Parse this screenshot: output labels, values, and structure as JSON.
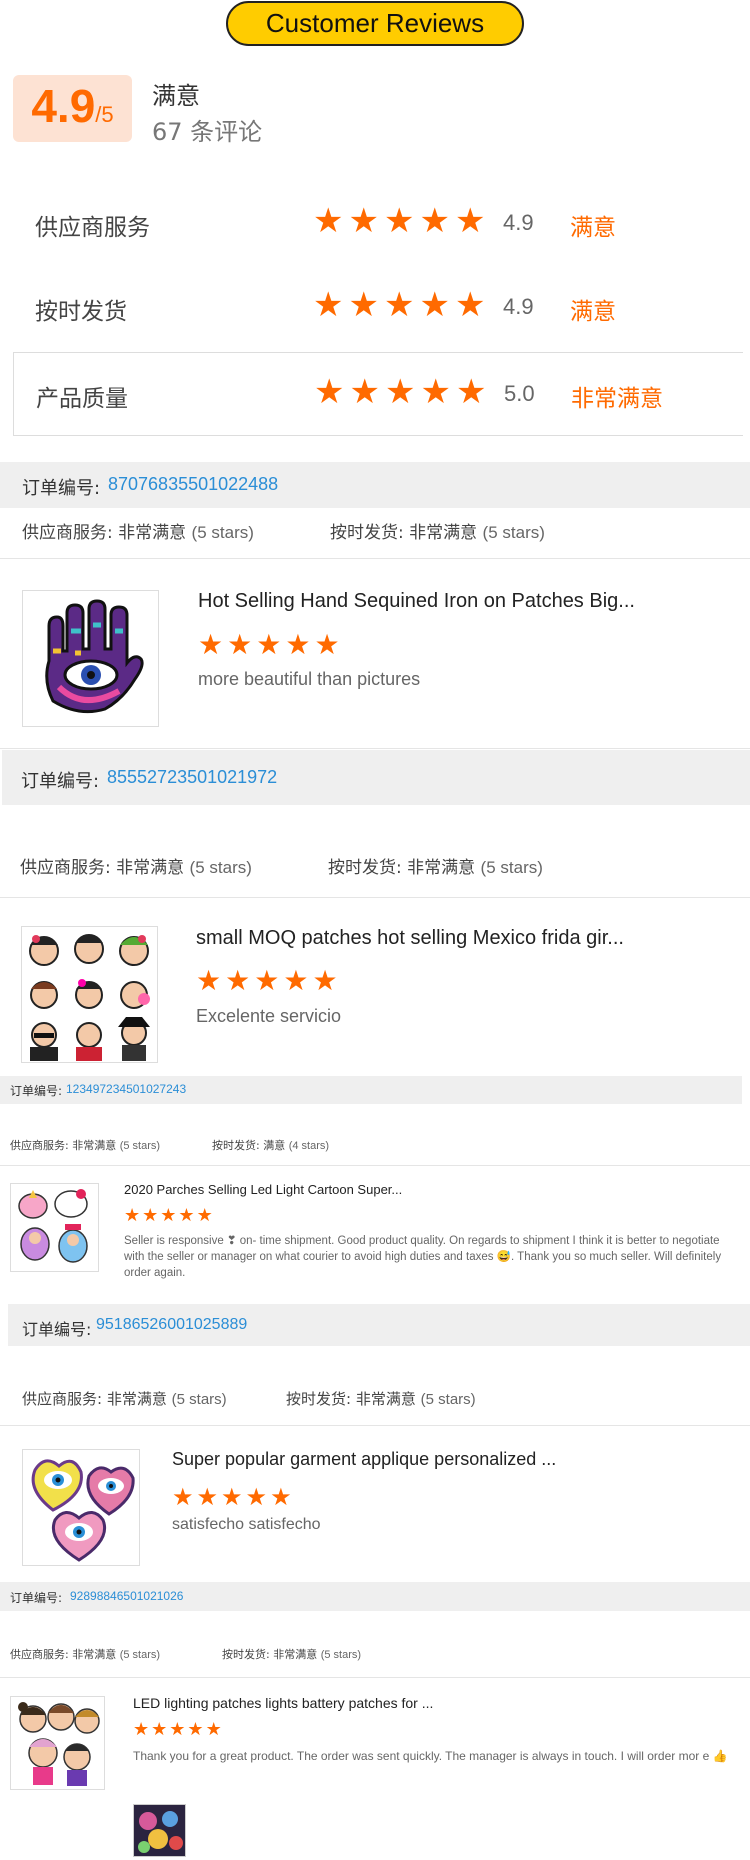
{
  "header": {
    "title": "Customer Reviews"
  },
  "summary": {
    "score": "4.9",
    "score_suffix": "/5",
    "label": "满意",
    "count_text": "67 条评论"
  },
  "ratings": [
    {
      "label": "供应商服务",
      "score": "4.9",
      "text": "满意",
      "stars": 5
    },
    {
      "label": "按时发货",
      "score": "4.9",
      "text": "满意",
      "stars": 5
    },
    {
      "label": "产品质量",
      "score": "5.0",
      "text": "非常满意",
      "stars": 5
    }
  ],
  "reviews": [
    {
      "order_label": "订单编号:",
      "order_number": "87076835501022488",
      "service_label": "供应商服务:",
      "service_value": "非常满意",
      "service_stars": "(5 stars)",
      "shipping_label": "按时发货:",
      "shipping_value": "非常满意",
      "shipping_stars": "(5 stars)",
      "product_title": "Hot Selling Hand Sequined Iron on Patches Big...",
      "rating": 5,
      "comment": "more beautiful than pictures"
    },
    {
      "order_label": "订单编号:",
      "order_number": "85552723501021972",
      "service_label": "供应商服务:",
      "service_value": "非常满意",
      "service_stars": "(5 stars)",
      "shipping_label": "按时发货:",
      "shipping_value": "非常满意",
      "shipping_stars": "(5 stars)",
      "product_title": "small MOQ patches hot selling Mexico frida gir...",
      "rating": 5,
      "comment": "Excelente servicio"
    },
    {
      "order_label": "订单编号:",
      "order_number": "123497234501027243",
      "service_label": "供应商服务:",
      "service_value": "非常满意",
      "service_stars": "(5 stars)",
      "shipping_label": "按时发货:",
      "shipping_value": "满意",
      "shipping_stars": "(4 stars)",
      "product_title": "2020 Parches Selling Led Light Cartoon Super...",
      "rating": 5,
      "comment": "Seller is responsive ❣ on- time shipment. Good product quality. On regards to shipment I think it is better to negotiate with the seller or manager on what courier to avoid high duties and taxes 😅. Thank you so much seller. Will definitely order again."
    },
    {
      "order_label": "订单编号:",
      "order_number": "95186526001025889",
      "service_label": "供应商服务:",
      "service_value": "非常满意",
      "service_stars": "(5 stars)",
      "shipping_label": "按时发货:",
      "shipping_value": "非常满意",
      "shipping_stars": "(5 stars)",
      "product_title": "Super popular garment applique personalized ...",
      "rating": 5,
      "comment": "satisfecho satisfecho"
    },
    {
      "order_label": "订单编号:",
      "order_number": "92898846501021026",
      "service_label": "供应商服务:",
      "service_value": "非常满意",
      "service_stars": "(5 stars)",
      "shipping_label": "按时发货:",
      "shipping_value": "非常满意",
      "shipping_stars": "(5 stars)",
      "product_title": "LED lighting patches lights battery patches for ...",
      "rating": 5,
      "comment": "Thank you for a great product. The order was sent quickly. The manager is always in touch. I will order mor e 👍"
    }
  ],
  "colors": {
    "accent": "#ff6a00",
    "link": "#2b8ed6",
    "title_bg": "#ffcc00"
  }
}
